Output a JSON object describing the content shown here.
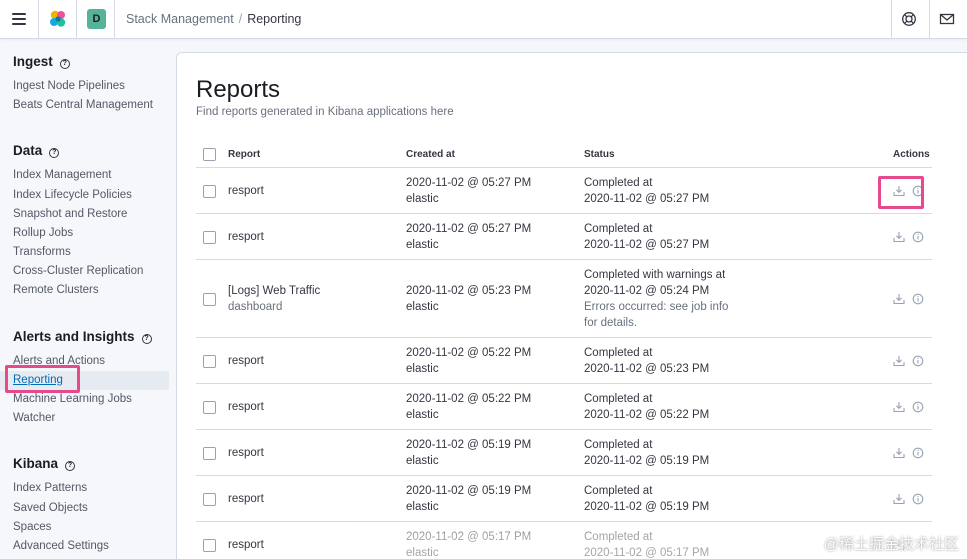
{
  "header": {
    "space_initial": "D",
    "breadcrumbs": [
      "Stack Management",
      "Reporting"
    ]
  },
  "sidebar": {
    "sections": [
      {
        "title": "Ingest",
        "items": [
          "Ingest Node Pipelines",
          "Beats Central Management"
        ]
      },
      {
        "title": "Data",
        "items": [
          "Index Management",
          "Index Lifecycle Policies",
          "Snapshot and Restore",
          "Rollup Jobs",
          "Transforms",
          "Cross-Cluster Replication",
          "Remote Clusters"
        ]
      },
      {
        "title": "Alerts and Insights",
        "items": [
          "Alerts and Actions",
          "Reporting",
          "Machine Learning Jobs",
          "Watcher"
        ]
      },
      {
        "title": "Kibana",
        "items": [
          "Index Patterns",
          "Saved Objects",
          "Spaces",
          "Advanced Settings"
        ]
      }
    ],
    "active_item": "Reporting"
  },
  "main": {
    "title": "Reports",
    "description": "Find reports generated in Kibana applications here",
    "columns": {
      "report": "Report",
      "created": "Created at",
      "status": "Status",
      "actions": "Actions"
    },
    "rows": [
      {
        "report": "resport",
        "report_sub": "",
        "created": "2020-11-02 @ 05:27 PM",
        "created_by": "elastic",
        "status": "Completed at",
        "status_time": "2020-11-02 @ 05:27 PM",
        "status_note": ""
      },
      {
        "report": "resport",
        "report_sub": "",
        "created": "2020-11-02 @ 05:27 PM",
        "created_by": "elastic",
        "status": "Completed at",
        "status_time": "2020-11-02 @ 05:27 PM",
        "status_note": ""
      },
      {
        "report": "[Logs] Web Traffic",
        "report_sub": "dashboard",
        "created": "2020-11-02 @ 05:23 PM",
        "created_by": "elastic",
        "status": "Completed with warnings at",
        "status_time": "2020-11-02 @ 05:24 PM",
        "status_note": "Errors occurred: see job info for details."
      },
      {
        "report": "resport",
        "report_sub": "",
        "created": "2020-11-02 @ 05:22 PM",
        "created_by": "elastic",
        "status": "Completed at",
        "status_time": "2020-11-02 @ 05:23 PM",
        "status_note": ""
      },
      {
        "report": "resport",
        "report_sub": "",
        "created": "2020-11-02 @ 05:22 PM",
        "created_by": "elastic",
        "status": "Completed at",
        "status_time": "2020-11-02 @ 05:22 PM",
        "status_note": ""
      },
      {
        "report": "resport",
        "report_sub": "",
        "created": "2020-11-02 @ 05:19 PM",
        "created_by": "elastic",
        "status": "Completed at",
        "status_time": "2020-11-02 @ 05:19 PM",
        "status_note": ""
      },
      {
        "report": "resport",
        "report_sub": "",
        "created": "2020-11-02 @ 05:19 PM",
        "created_by": "elastic",
        "status": "Completed at",
        "status_time": "2020-11-02 @ 05:19 PM",
        "status_note": ""
      },
      {
        "report": "resport",
        "report_sub": "",
        "created": "2020-11-02 @ 05:17 PM",
        "created_by": "elastic",
        "status": "Completed at",
        "status_time": "2020-11-02 @ 05:17 PM",
        "status_note": ""
      }
    ]
  },
  "watermark": "@稀土掘金技术社区",
  "colors": {
    "accent": "#006bb8",
    "highlight": "#e7498d",
    "space_badge": "#54b399"
  }
}
